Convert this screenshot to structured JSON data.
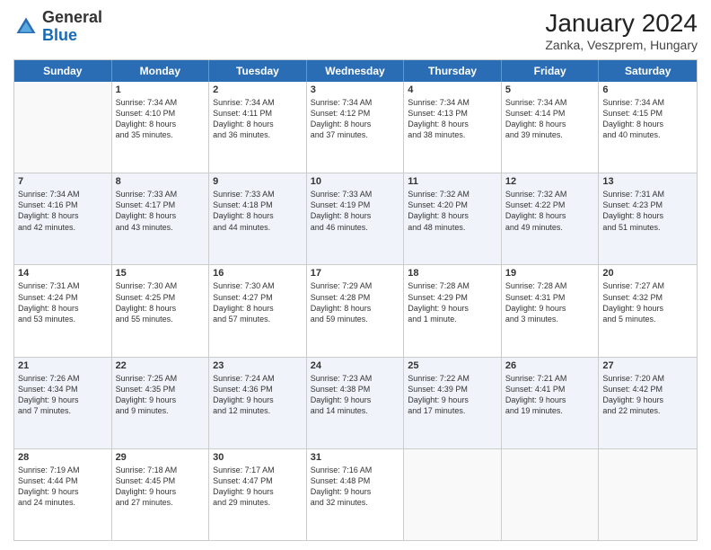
{
  "header": {
    "logo_general": "General",
    "logo_blue": "Blue",
    "month_year": "January 2024",
    "location": "Zanka, Veszprem, Hungary"
  },
  "days_of_week": [
    "Sunday",
    "Monday",
    "Tuesday",
    "Wednesday",
    "Thursday",
    "Friday",
    "Saturday"
  ],
  "rows": [
    {
      "alt": false,
      "cells": [
        {
          "day": "",
          "info": ""
        },
        {
          "day": "1",
          "info": "Sunrise: 7:34 AM\nSunset: 4:10 PM\nDaylight: 8 hours\nand 35 minutes."
        },
        {
          "day": "2",
          "info": "Sunrise: 7:34 AM\nSunset: 4:11 PM\nDaylight: 8 hours\nand 36 minutes."
        },
        {
          "day": "3",
          "info": "Sunrise: 7:34 AM\nSunset: 4:12 PM\nDaylight: 8 hours\nand 37 minutes."
        },
        {
          "day": "4",
          "info": "Sunrise: 7:34 AM\nSunset: 4:13 PM\nDaylight: 8 hours\nand 38 minutes."
        },
        {
          "day": "5",
          "info": "Sunrise: 7:34 AM\nSunset: 4:14 PM\nDaylight: 8 hours\nand 39 minutes."
        },
        {
          "day": "6",
          "info": "Sunrise: 7:34 AM\nSunset: 4:15 PM\nDaylight: 8 hours\nand 40 minutes."
        }
      ]
    },
    {
      "alt": true,
      "cells": [
        {
          "day": "7",
          "info": "Sunrise: 7:34 AM\nSunset: 4:16 PM\nDaylight: 8 hours\nand 42 minutes."
        },
        {
          "day": "8",
          "info": "Sunrise: 7:33 AM\nSunset: 4:17 PM\nDaylight: 8 hours\nand 43 minutes."
        },
        {
          "day": "9",
          "info": "Sunrise: 7:33 AM\nSunset: 4:18 PM\nDaylight: 8 hours\nand 44 minutes."
        },
        {
          "day": "10",
          "info": "Sunrise: 7:33 AM\nSunset: 4:19 PM\nDaylight: 8 hours\nand 46 minutes."
        },
        {
          "day": "11",
          "info": "Sunrise: 7:32 AM\nSunset: 4:20 PM\nDaylight: 8 hours\nand 48 minutes."
        },
        {
          "day": "12",
          "info": "Sunrise: 7:32 AM\nSunset: 4:22 PM\nDaylight: 8 hours\nand 49 minutes."
        },
        {
          "day": "13",
          "info": "Sunrise: 7:31 AM\nSunset: 4:23 PM\nDaylight: 8 hours\nand 51 minutes."
        }
      ]
    },
    {
      "alt": false,
      "cells": [
        {
          "day": "14",
          "info": "Sunrise: 7:31 AM\nSunset: 4:24 PM\nDaylight: 8 hours\nand 53 minutes."
        },
        {
          "day": "15",
          "info": "Sunrise: 7:30 AM\nSunset: 4:25 PM\nDaylight: 8 hours\nand 55 minutes."
        },
        {
          "day": "16",
          "info": "Sunrise: 7:30 AM\nSunset: 4:27 PM\nDaylight: 8 hours\nand 57 minutes."
        },
        {
          "day": "17",
          "info": "Sunrise: 7:29 AM\nSunset: 4:28 PM\nDaylight: 8 hours\nand 59 minutes."
        },
        {
          "day": "18",
          "info": "Sunrise: 7:28 AM\nSunset: 4:29 PM\nDaylight: 9 hours\nand 1 minute."
        },
        {
          "day": "19",
          "info": "Sunrise: 7:28 AM\nSunset: 4:31 PM\nDaylight: 9 hours\nand 3 minutes."
        },
        {
          "day": "20",
          "info": "Sunrise: 7:27 AM\nSunset: 4:32 PM\nDaylight: 9 hours\nand 5 minutes."
        }
      ]
    },
    {
      "alt": true,
      "cells": [
        {
          "day": "21",
          "info": "Sunrise: 7:26 AM\nSunset: 4:34 PM\nDaylight: 9 hours\nand 7 minutes."
        },
        {
          "day": "22",
          "info": "Sunrise: 7:25 AM\nSunset: 4:35 PM\nDaylight: 9 hours\nand 9 minutes."
        },
        {
          "day": "23",
          "info": "Sunrise: 7:24 AM\nSunset: 4:36 PM\nDaylight: 9 hours\nand 12 minutes."
        },
        {
          "day": "24",
          "info": "Sunrise: 7:23 AM\nSunset: 4:38 PM\nDaylight: 9 hours\nand 14 minutes."
        },
        {
          "day": "25",
          "info": "Sunrise: 7:22 AM\nSunset: 4:39 PM\nDaylight: 9 hours\nand 17 minutes."
        },
        {
          "day": "26",
          "info": "Sunrise: 7:21 AM\nSunset: 4:41 PM\nDaylight: 9 hours\nand 19 minutes."
        },
        {
          "day": "27",
          "info": "Sunrise: 7:20 AM\nSunset: 4:42 PM\nDaylight: 9 hours\nand 22 minutes."
        }
      ]
    },
    {
      "alt": false,
      "cells": [
        {
          "day": "28",
          "info": "Sunrise: 7:19 AM\nSunset: 4:44 PM\nDaylight: 9 hours\nand 24 minutes."
        },
        {
          "day": "29",
          "info": "Sunrise: 7:18 AM\nSunset: 4:45 PM\nDaylight: 9 hours\nand 27 minutes."
        },
        {
          "day": "30",
          "info": "Sunrise: 7:17 AM\nSunset: 4:47 PM\nDaylight: 9 hours\nand 29 minutes."
        },
        {
          "day": "31",
          "info": "Sunrise: 7:16 AM\nSunset: 4:48 PM\nDaylight: 9 hours\nand 32 minutes."
        },
        {
          "day": "",
          "info": ""
        },
        {
          "day": "",
          "info": ""
        },
        {
          "day": "",
          "info": ""
        }
      ]
    }
  ]
}
